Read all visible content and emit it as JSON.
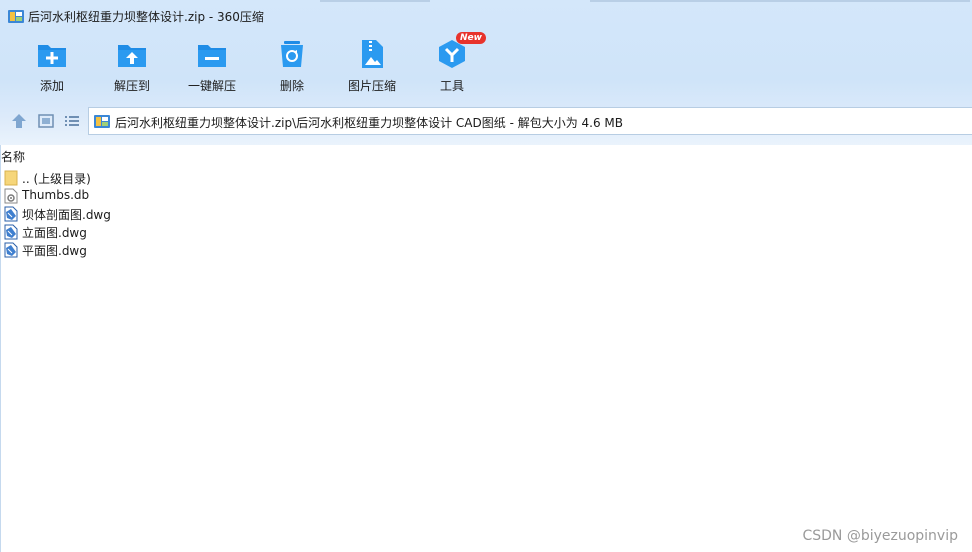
{
  "window": {
    "title": "后河水利枢纽重力坝整体设计.zip - 360压缩"
  },
  "toolbar": {
    "items": [
      {
        "label": "添加",
        "icon": "add-folder-icon"
      },
      {
        "label": "解压到",
        "icon": "extract-to-folder-icon"
      },
      {
        "label": "一键解压",
        "icon": "one-click-extract-icon"
      },
      {
        "label": "删除",
        "icon": "recycle-bin-icon"
      },
      {
        "label": "图片压缩",
        "icon": "image-compress-icon"
      },
      {
        "label": "工具",
        "icon": "tools-cube-icon",
        "badge": "New"
      }
    ]
  },
  "address": {
    "path": "后河水利枢纽重力坝整体设计.zip\\后河水利枢纽重力坝整体设计 CAD图纸 - 解包大小为 4.6 MB"
  },
  "list": {
    "column_name": "名称",
    "files": [
      {
        "name": ".. (上级目录)",
        "icon": "folder-icon"
      },
      {
        "name": "Thumbs.db",
        "icon": "settings-file-icon"
      },
      {
        "name": "坝体剖面图.dwg",
        "icon": "dwg-file-icon"
      },
      {
        "name": "立面图.dwg",
        "icon": "dwg-file-icon"
      },
      {
        "name": "平面图.dwg",
        "icon": "dwg-file-icon"
      }
    ]
  },
  "watermark": "CSDN @biyezuopinvip",
  "colors": {
    "accent": "#1f8ce6",
    "chrome_bg": "#d4e7fa",
    "badge": "#e8332c"
  }
}
